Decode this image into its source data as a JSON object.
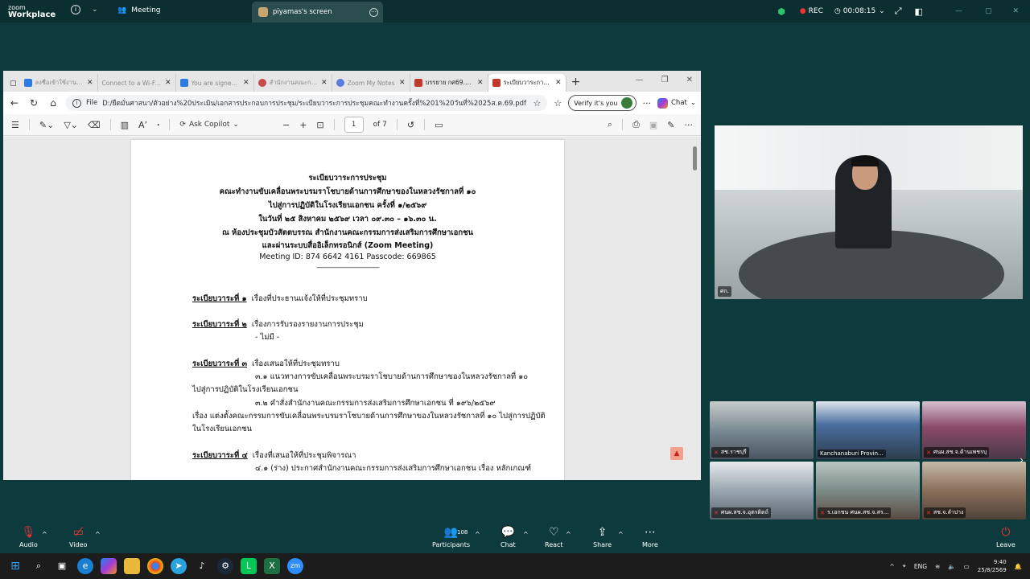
{
  "zoom": {
    "logo_line1": "zoom",
    "logo_line2": "Workplace",
    "meeting_label": "Meeting",
    "screen_share_label": "piyamas's screen",
    "rec_label": "REC",
    "timer": "00:08:15"
  },
  "browser": {
    "tabs": [
      {
        "label": "ลงชื่อเข้าใช้งานแก้ไขแ",
        "icon": "S",
        "color": "#2d7be0"
      },
      {
        "label": "Connect to a Wi-Fi ne",
        "icon": "",
        "color": "#e6e6e6"
      },
      {
        "label": "You are signed in",
        "icon": "S",
        "color": "#2d7be0"
      },
      {
        "label": "สำนักงานคณะกรรมการส่งเ",
        "icon": "",
        "color": "#c94a4a"
      },
      {
        "label": "Zoom My Notes",
        "icon": "zm",
        "color": "#5a7be0"
      },
      {
        "label": "บรรยาย กศ69.pdf",
        "icon": "",
        "color": "#c0392b"
      },
      {
        "label": "ระเบียบวาระการประชุม",
        "icon": "",
        "color": "#c0392b"
      }
    ],
    "url_prefix": "File",
    "url": "D:/ยืดมั่นศาสนา/ตัวอย่าง%20ประเมิน/เอกสารประกอบการประชุม/ระเบียบวาระการประชุมคณะทำงานครั้งที่%201%20วันที่%2025ส.ค.69.pdf",
    "verify_label": "Verify it's you",
    "chat_label": "Chat",
    "pdf_toolbar": {
      "ask_copilot": "Ask Copilot",
      "page_current": "1",
      "page_total": "of 7"
    }
  },
  "pdf": {
    "title_lines": [
      "ระเบียบวาระการประชุม",
      "คณะทำงานขับเคลื่อนพระบรมราโชบายด้านการศึกษาของในหลวงรัชกาลที่ ๑๐",
      "ไปสู่การปฏิบัติในโรงเรียนเอกชน ครั้งที่ ๑/๒๕๖๙",
      "ในวันที่ ๒๕ สิงหาคม ๒๕๖๙ เวลา ๐๙.๓๐ – ๑๖.๓๐ น.",
      "ณ ห้องประชุมบัวสัตตบรรณ สำนักงานคณะกรรมการส่งเสริมการศึกษาเอกชน",
      "และผ่านระบบสื่ออิเล็กทรอนิกส์ (Zoom Meeting)"
    ],
    "meeting_id": "Meeting ID: 874 6642 4161 Passcode: 669865",
    "divider": "---------------------------------------------------",
    "agenda1_head": "ระเบียบวาระที่ ๑",
    "agenda1_text": "เรื่องที่ประธานแจ้งให้ที่ประชุมทราบ",
    "agenda2_head": "ระเบียบวาระที่ ๒",
    "agenda2_text": "เรื่องการรับรองรายงานการประชุม",
    "agenda2_sub": "- ไม่มี -",
    "agenda3_head": "ระเบียบวาระที่ ๓",
    "agenda3_text": "เรื่องเสนอให้ที่ประชุมทราบ",
    "agenda3_1a": "๓.๑  แนวทางการขับเคลื่อนพระบรมราโชบายด้านการศึกษาของในหลวงรัชกาลที่  ๑๐",
    "agenda3_1b": "ไปสู่การปฏิบัติในโรงเรียนเอกชน",
    "agenda3_2a": "๓.๒  คำสั่งสำนักงานคณะกรรมการส่งเสริมการศึกษาเอกชน  ที่  ๑๙๖/๒๕๖๙",
    "agenda3_2b": "เรื่อง แต่งตั้งคณะกรรมการขับเคลื่อนพระบรมราโชบายด้านการศึกษาของในหลวงรัชกาลที่ ๑๐ ไปสู่การปฏิบัติ",
    "agenda3_2c": "ในโรงเรียนเอกชน",
    "agenda4_head": "ระเบียบวาระที่ ๔",
    "agenda4_text": "เรื่องที่เสนอให้ที่ประชุมพิจารณา",
    "agenda4_1a": "๔.๑  (ร่าง) ประกาศสำนักงานคณะกรรมการส่งเสริมการศึกษาเอกชน เรื่อง หลักเกณฑ์"
  },
  "video": {
    "speaker_label": "ศก.",
    "tiles": [
      {
        "label": "สช.ราชบุรี",
        "bg": "#7a8a94"
      },
      {
        "label": "Kanchanaburi Provin...",
        "bg": "#4b6fa0"
      },
      {
        "label": "ศนผ.สช.จ.ด้านเพชรบุ",
        "bg": "#8a4a6a"
      },
      {
        "label": "ศนผ.สช.จ.อุตรดิตถ์",
        "bg": "#9aa6b0"
      },
      {
        "label": "ร.เอกชน ศนผ.สช.จ.สร...",
        "bg": "#7d8c88"
      },
      {
        "label": "สช.จ.ลำปาง",
        "bg": "#8a6f5a"
      }
    ]
  },
  "toolbar": {
    "audio": "Audio",
    "video": "Video",
    "participants": "Participants",
    "participants_count": "108",
    "chat": "Chat",
    "react": "React",
    "share": "Share",
    "more": "More",
    "leave": "Leave"
  },
  "taskbar": {
    "lang": "ENG",
    "time": "9:40",
    "date": "25/8/2569"
  }
}
